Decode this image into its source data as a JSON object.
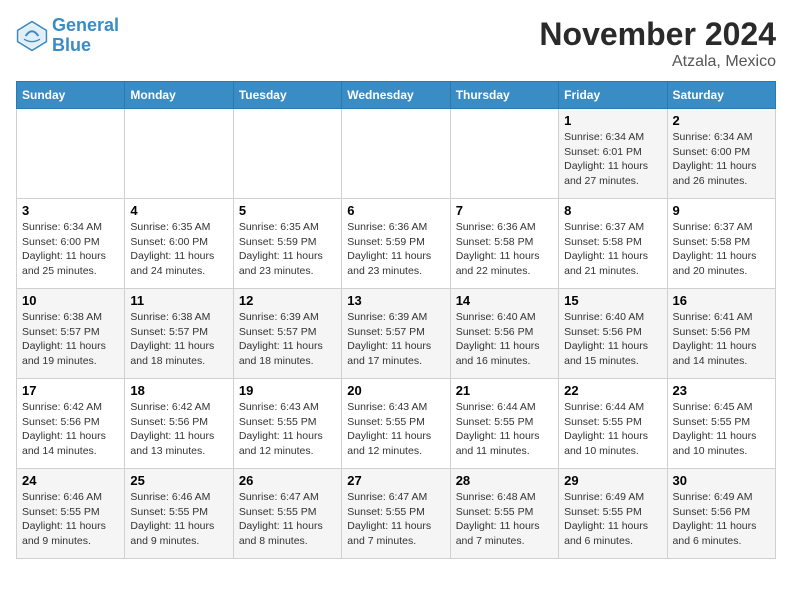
{
  "logo": {
    "line1": "General",
    "line2": "Blue"
  },
  "title": "November 2024",
  "subtitle": "Atzala, Mexico",
  "days_of_week": [
    "Sunday",
    "Monday",
    "Tuesday",
    "Wednesday",
    "Thursday",
    "Friday",
    "Saturday"
  ],
  "weeks": [
    [
      {
        "day": "",
        "info": ""
      },
      {
        "day": "",
        "info": ""
      },
      {
        "day": "",
        "info": ""
      },
      {
        "day": "",
        "info": ""
      },
      {
        "day": "",
        "info": ""
      },
      {
        "day": "1",
        "info": "Sunrise: 6:34 AM\nSunset: 6:01 PM\nDaylight: 11 hours and 27 minutes."
      },
      {
        "day": "2",
        "info": "Sunrise: 6:34 AM\nSunset: 6:00 PM\nDaylight: 11 hours and 26 minutes."
      }
    ],
    [
      {
        "day": "3",
        "info": "Sunrise: 6:34 AM\nSunset: 6:00 PM\nDaylight: 11 hours and 25 minutes."
      },
      {
        "day": "4",
        "info": "Sunrise: 6:35 AM\nSunset: 6:00 PM\nDaylight: 11 hours and 24 minutes."
      },
      {
        "day": "5",
        "info": "Sunrise: 6:35 AM\nSunset: 5:59 PM\nDaylight: 11 hours and 23 minutes."
      },
      {
        "day": "6",
        "info": "Sunrise: 6:36 AM\nSunset: 5:59 PM\nDaylight: 11 hours and 23 minutes."
      },
      {
        "day": "7",
        "info": "Sunrise: 6:36 AM\nSunset: 5:58 PM\nDaylight: 11 hours and 22 minutes."
      },
      {
        "day": "8",
        "info": "Sunrise: 6:37 AM\nSunset: 5:58 PM\nDaylight: 11 hours and 21 minutes."
      },
      {
        "day": "9",
        "info": "Sunrise: 6:37 AM\nSunset: 5:58 PM\nDaylight: 11 hours and 20 minutes."
      }
    ],
    [
      {
        "day": "10",
        "info": "Sunrise: 6:38 AM\nSunset: 5:57 PM\nDaylight: 11 hours and 19 minutes."
      },
      {
        "day": "11",
        "info": "Sunrise: 6:38 AM\nSunset: 5:57 PM\nDaylight: 11 hours and 18 minutes."
      },
      {
        "day": "12",
        "info": "Sunrise: 6:39 AM\nSunset: 5:57 PM\nDaylight: 11 hours and 18 minutes."
      },
      {
        "day": "13",
        "info": "Sunrise: 6:39 AM\nSunset: 5:57 PM\nDaylight: 11 hours and 17 minutes."
      },
      {
        "day": "14",
        "info": "Sunrise: 6:40 AM\nSunset: 5:56 PM\nDaylight: 11 hours and 16 minutes."
      },
      {
        "day": "15",
        "info": "Sunrise: 6:40 AM\nSunset: 5:56 PM\nDaylight: 11 hours and 15 minutes."
      },
      {
        "day": "16",
        "info": "Sunrise: 6:41 AM\nSunset: 5:56 PM\nDaylight: 11 hours and 14 minutes."
      }
    ],
    [
      {
        "day": "17",
        "info": "Sunrise: 6:42 AM\nSunset: 5:56 PM\nDaylight: 11 hours and 14 minutes."
      },
      {
        "day": "18",
        "info": "Sunrise: 6:42 AM\nSunset: 5:56 PM\nDaylight: 11 hours and 13 minutes."
      },
      {
        "day": "19",
        "info": "Sunrise: 6:43 AM\nSunset: 5:55 PM\nDaylight: 11 hours and 12 minutes."
      },
      {
        "day": "20",
        "info": "Sunrise: 6:43 AM\nSunset: 5:55 PM\nDaylight: 11 hours and 12 minutes."
      },
      {
        "day": "21",
        "info": "Sunrise: 6:44 AM\nSunset: 5:55 PM\nDaylight: 11 hours and 11 minutes."
      },
      {
        "day": "22",
        "info": "Sunrise: 6:44 AM\nSunset: 5:55 PM\nDaylight: 11 hours and 10 minutes."
      },
      {
        "day": "23",
        "info": "Sunrise: 6:45 AM\nSunset: 5:55 PM\nDaylight: 11 hours and 10 minutes."
      }
    ],
    [
      {
        "day": "24",
        "info": "Sunrise: 6:46 AM\nSunset: 5:55 PM\nDaylight: 11 hours and 9 minutes."
      },
      {
        "day": "25",
        "info": "Sunrise: 6:46 AM\nSunset: 5:55 PM\nDaylight: 11 hours and 9 minutes."
      },
      {
        "day": "26",
        "info": "Sunrise: 6:47 AM\nSunset: 5:55 PM\nDaylight: 11 hours and 8 minutes."
      },
      {
        "day": "27",
        "info": "Sunrise: 6:47 AM\nSunset: 5:55 PM\nDaylight: 11 hours and 7 minutes."
      },
      {
        "day": "28",
        "info": "Sunrise: 6:48 AM\nSunset: 5:55 PM\nDaylight: 11 hours and 7 minutes."
      },
      {
        "day": "29",
        "info": "Sunrise: 6:49 AM\nSunset: 5:55 PM\nDaylight: 11 hours and 6 minutes."
      },
      {
        "day": "30",
        "info": "Sunrise: 6:49 AM\nSunset: 5:56 PM\nDaylight: 11 hours and 6 minutes."
      }
    ]
  ]
}
